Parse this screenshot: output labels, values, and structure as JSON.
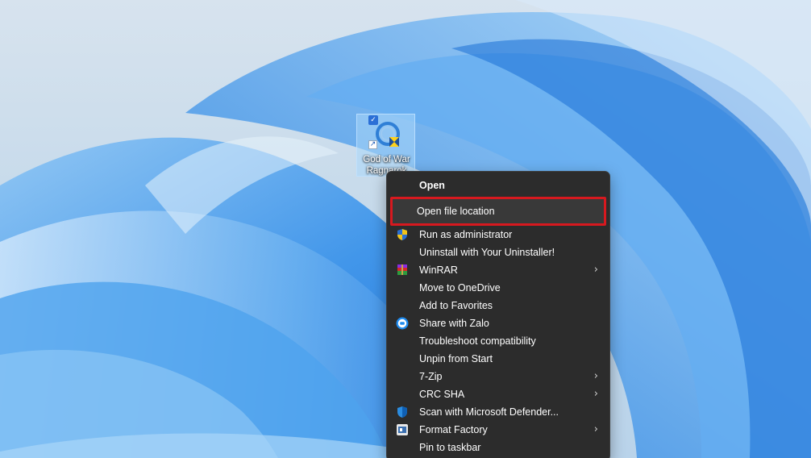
{
  "desktop": {
    "icon": {
      "label": "God of War Ragnarok",
      "selected": true,
      "checkbox_glyph": "✓",
      "shortcut_glyph": "↗",
      "icon_name": "god-of-war-game-icon"
    }
  },
  "context_menu": {
    "items": [
      {
        "label": "Open",
        "icon": "",
        "submenu": false
      },
      {
        "label": "Open file location",
        "icon": "",
        "submenu": false,
        "highlighted": true
      },
      {
        "label": "Run as administrator",
        "icon": "uac-shield-icon",
        "submenu": false
      },
      {
        "label": "Uninstall with Your Uninstaller!",
        "icon": "",
        "submenu": false
      },
      {
        "label": "WinRAR",
        "icon": "winrar-icon",
        "submenu": true
      },
      {
        "label": "Move to OneDrive",
        "icon": "",
        "submenu": false
      },
      {
        "label": "Add to Favorites",
        "icon": "",
        "submenu": false
      },
      {
        "label": "Share with Zalo",
        "icon": "zalo-icon",
        "submenu": false
      },
      {
        "label": "Troubleshoot compatibility",
        "icon": "",
        "submenu": false
      },
      {
        "label": "Unpin from Start",
        "icon": "",
        "submenu": false
      },
      {
        "label": "7-Zip",
        "icon": "",
        "submenu": true
      },
      {
        "label": "CRC SHA",
        "icon": "",
        "submenu": true
      },
      {
        "label": "Scan with Microsoft Defender...",
        "icon": "defender-shield-icon",
        "submenu": false
      },
      {
        "label": "Format Factory",
        "icon": "format-factory-icon",
        "submenu": true
      },
      {
        "label": "Pin to taskbar",
        "icon": "",
        "submenu": false
      }
    ],
    "chevron_glyph": "›",
    "highlight_color": "#d7191f"
  },
  "colors": {
    "menu_background": "#2c2c2c",
    "menu_text": "#ffffff",
    "selection_fill": "#8fcaf5"
  }
}
